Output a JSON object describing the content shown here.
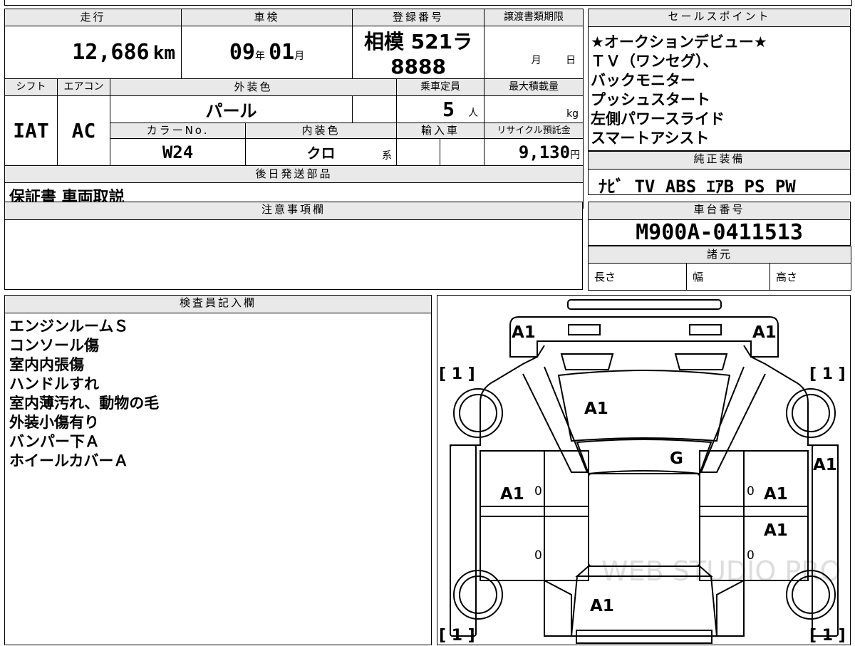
{
  "top_strip_text": "・",
  "mileage": {
    "label": "走行",
    "value": "12,686",
    "unit": "km"
  },
  "shaken": {
    "label": "車検",
    "year": "09",
    "year_unit": "年",
    "month": "01",
    "month_unit": "月"
  },
  "registration": {
    "label": "登録番号",
    "value": "相模 521ラ8888"
  },
  "transfer_deadline": {
    "label": "譲渡書類期限",
    "month_unit": "月",
    "day_unit": "日"
  },
  "shift": {
    "label": "シフト",
    "value": "IAT"
  },
  "aircon": {
    "label": "エアコン",
    "value": "AC"
  },
  "exterior_color": {
    "label": "外装色",
    "value": "パール"
  },
  "capacity": {
    "label": "乗車定員",
    "value": "5",
    "unit": "人"
  },
  "max_load": {
    "label": "最大積載量",
    "unit": "kg"
  },
  "color_no": {
    "label": "カラーNo.",
    "value": "W24"
  },
  "interior_color": {
    "label": "内装色",
    "value": "クロ",
    "suffix": "系"
  },
  "import": {
    "label": "輸入車"
  },
  "recycle_fee": {
    "label": "リサイクル預託金",
    "value": "9,130",
    "unit": "円"
  },
  "later_parts": {
    "label": "後日発送部品",
    "value": "保証書 車両取説"
  },
  "sales_points": {
    "label": "セールスポイント",
    "lines": [
      "★オークションデビュー★",
      "ＴＶ（ワンセグ）、",
      "バックモニター",
      "プッシュスタート",
      "左側パワースライド",
      "スマートアシスト"
    ]
  },
  "genuine_equipment": {
    "label": "純正装備",
    "value": "ﾅﾋﾞ TV ABS ｴｱB PS PW"
  },
  "notes": {
    "label": "注意事項欄"
  },
  "chassis_no": {
    "label": "車台番号",
    "value": "M900A-0411513"
  },
  "specs": {
    "label": "諸元",
    "length": "長さ",
    "width": "幅",
    "height": "高さ"
  },
  "inspector": {
    "label": "検査員記入欄",
    "lines": [
      "エンジンルームＳ",
      "コンソール傷",
      "室内内張傷",
      "ハンドルすれ",
      "室内薄汚れ、動物の毛",
      "外装小傷有り",
      "バンパー下Ａ",
      "ホイールカバーＡ"
    ]
  },
  "diagram": {
    "watermark": "WEB STUDIO PRO",
    "bracket_marks": [
      "[ 1 ]",
      "[ 1 ]",
      "[ 1 ]",
      "[ 1 ]"
    ],
    "zero_marks": [
      "0",
      "0",
      "0",
      "0"
    ],
    "damage": {
      "front_left": "A1",
      "front_right": "A1",
      "hood": "A1",
      "windshield": "G",
      "front_door_left": "A1",
      "front_door_right": "A1",
      "rear_door_right": "A1",
      "right_side": "A1",
      "rear_hatch": "A1"
    }
  }
}
